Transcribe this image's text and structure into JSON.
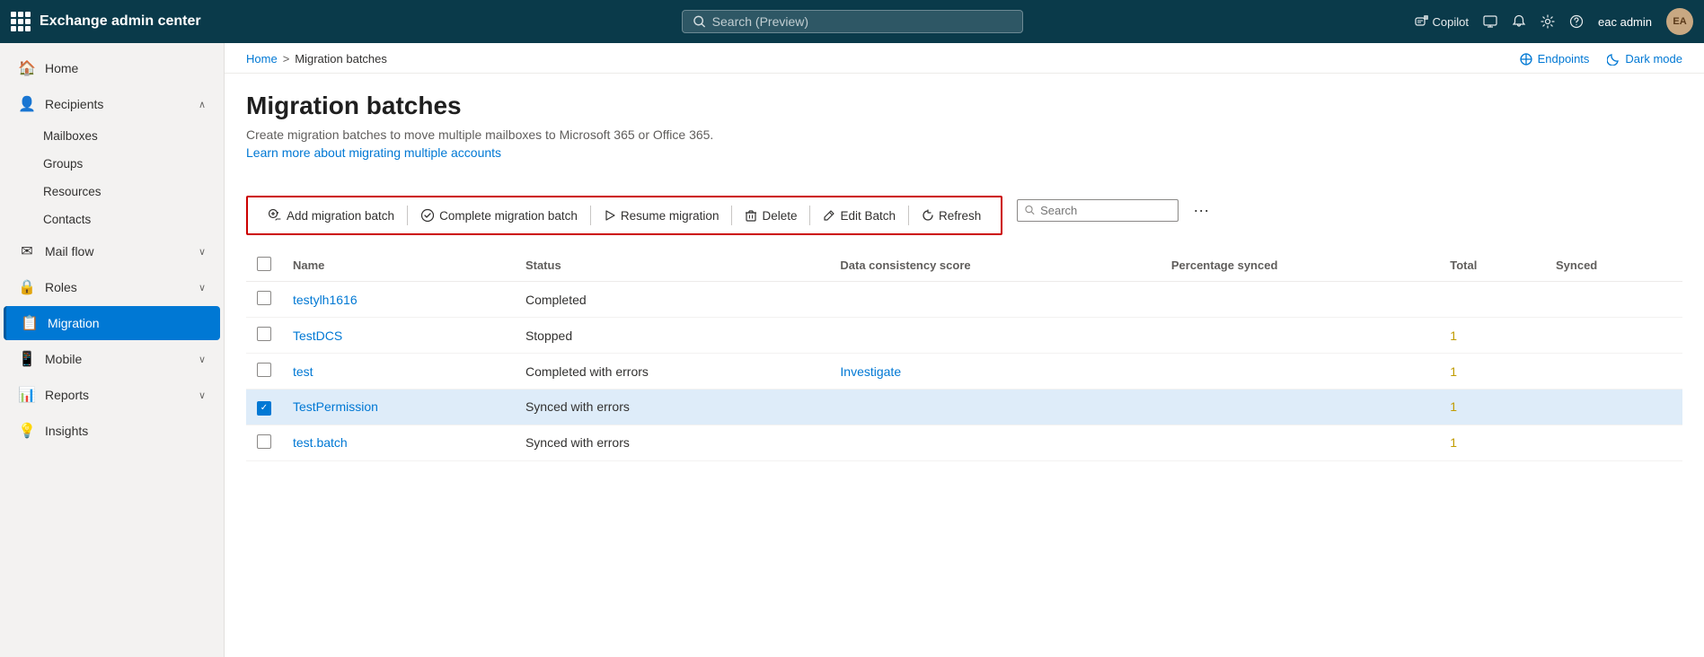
{
  "header": {
    "app_name": "Exchange admin center",
    "search_placeholder": "Search (Preview)",
    "copilot_label": "Copilot",
    "user_label": "eac admin",
    "user_initials": "EA"
  },
  "sidebar": {
    "items": [
      {
        "id": "home",
        "label": "Home",
        "icon": "🏠",
        "expandable": false,
        "active": false
      },
      {
        "id": "recipients",
        "label": "Recipients",
        "icon": "👤",
        "expandable": true,
        "expanded": true,
        "active": false
      },
      {
        "id": "mail-flow",
        "label": "Mail flow",
        "icon": "✉",
        "expandable": true,
        "expanded": false,
        "active": false
      },
      {
        "id": "roles",
        "label": "Roles",
        "icon": "🔒",
        "expandable": true,
        "expanded": false,
        "active": false
      },
      {
        "id": "migration",
        "label": "Migration",
        "icon": "📋",
        "expandable": false,
        "active": true
      },
      {
        "id": "mobile",
        "label": "Mobile",
        "icon": "📱",
        "expandable": true,
        "expanded": false,
        "active": false
      },
      {
        "id": "reports",
        "label": "Reports",
        "icon": "📊",
        "expandable": true,
        "expanded": false,
        "active": false
      },
      {
        "id": "insights",
        "label": "Insights",
        "icon": "💡",
        "expandable": false,
        "active": false
      }
    ],
    "sub_items": {
      "recipients": [
        "Mailboxes",
        "Groups",
        "Resources",
        "Contacts"
      ]
    }
  },
  "breadcrumb": {
    "home": "Home",
    "separator": ">",
    "current": "Migration batches"
  },
  "top_actions": {
    "endpoints_label": "Endpoints",
    "dark_mode_label": "Dark mode"
  },
  "page": {
    "title": "Migration batches",
    "description": "Create migration batches to move multiple mailboxes to Microsoft 365 or Office 365.",
    "link_text": "Learn more about migrating multiple accounts"
  },
  "toolbar": {
    "add_label": "Add migration batch",
    "complete_label": "Complete migration batch",
    "resume_label": "Resume migration",
    "delete_label": "Delete",
    "edit_label": "Edit Batch",
    "refresh_label": "Refresh",
    "search_placeholder": "Search"
  },
  "table": {
    "columns": [
      "Name",
      "Status",
      "Data consistency score",
      "Percentage synced",
      "Total",
      "Synced"
    ],
    "rows": [
      {
        "id": 1,
        "name": "testylh1616",
        "status": "Completed",
        "consistency": "",
        "percentage": "",
        "total": "",
        "synced": "",
        "selected": false
      },
      {
        "id": 2,
        "name": "TestDCS",
        "status": "Stopped",
        "consistency": "",
        "percentage": "",
        "total": "1",
        "synced": "",
        "selected": false
      },
      {
        "id": 3,
        "name": "test",
        "status": "Completed with errors",
        "consistency": "Investigate",
        "percentage": "",
        "total": "1",
        "synced": "",
        "selected": false
      },
      {
        "id": 4,
        "name": "TestPermission",
        "status": "Synced with errors",
        "consistency": "",
        "percentage": "",
        "total": "1",
        "synced": "",
        "selected": true
      },
      {
        "id": 5,
        "name": "test.batch",
        "status": "Synced with errors",
        "consistency": "",
        "percentage": "",
        "total": "1",
        "synced": "",
        "selected": false
      }
    ]
  },
  "colors": {
    "active_bg": "#deecf9",
    "link": "#0078d4",
    "brand": "#0a3a4a",
    "toolbar_border": "#cc0000",
    "total_orange": "#c19c00"
  }
}
